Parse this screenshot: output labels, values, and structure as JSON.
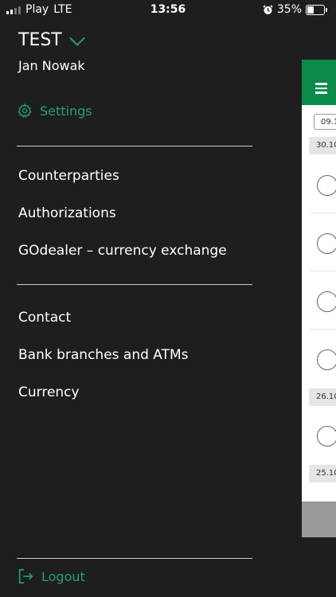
{
  "status_bar": {
    "carrier": "Play",
    "network": "LTE",
    "time": "13:56",
    "battery": "35%",
    "battery_level": 0.35
  },
  "drawer": {
    "company": "TEST",
    "user": "Jan Nowak",
    "settings_label": "Settings",
    "menu_group_1": [
      "Counterparties",
      "Authorizations",
      "GOdealer – currency exchange"
    ],
    "menu_group_2": [
      "Contact",
      "Bank branches and ATMs",
      "Currency"
    ],
    "logout_label": "Logout"
  },
  "background": {
    "date_filter": "09.1",
    "date_groups": [
      "30.10.",
      "26.10.",
      "25.10."
    ]
  },
  "colors": {
    "accent": "#27a06c",
    "drawer_bg": "#1e1e1e",
    "app_bar": "#0b8a4a"
  }
}
